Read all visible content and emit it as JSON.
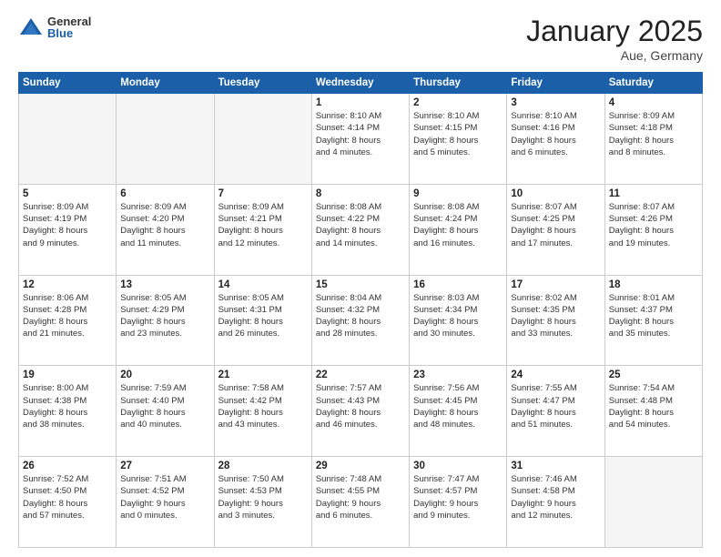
{
  "header": {
    "logo_general": "General",
    "logo_blue": "Blue",
    "title": "January 2025",
    "subtitle": "Aue, Germany"
  },
  "weekdays": [
    "Sunday",
    "Monday",
    "Tuesday",
    "Wednesday",
    "Thursday",
    "Friday",
    "Saturday"
  ],
  "weeks": [
    [
      {
        "day": "",
        "info": ""
      },
      {
        "day": "",
        "info": ""
      },
      {
        "day": "",
        "info": ""
      },
      {
        "day": "1",
        "info": "Sunrise: 8:10 AM\nSunset: 4:14 PM\nDaylight: 8 hours\nand 4 minutes."
      },
      {
        "day": "2",
        "info": "Sunrise: 8:10 AM\nSunset: 4:15 PM\nDaylight: 8 hours\nand 5 minutes."
      },
      {
        "day": "3",
        "info": "Sunrise: 8:10 AM\nSunset: 4:16 PM\nDaylight: 8 hours\nand 6 minutes."
      },
      {
        "day": "4",
        "info": "Sunrise: 8:09 AM\nSunset: 4:18 PM\nDaylight: 8 hours\nand 8 minutes."
      }
    ],
    [
      {
        "day": "5",
        "info": "Sunrise: 8:09 AM\nSunset: 4:19 PM\nDaylight: 8 hours\nand 9 minutes."
      },
      {
        "day": "6",
        "info": "Sunrise: 8:09 AM\nSunset: 4:20 PM\nDaylight: 8 hours\nand 11 minutes."
      },
      {
        "day": "7",
        "info": "Sunrise: 8:09 AM\nSunset: 4:21 PM\nDaylight: 8 hours\nand 12 minutes."
      },
      {
        "day": "8",
        "info": "Sunrise: 8:08 AM\nSunset: 4:22 PM\nDaylight: 8 hours\nand 14 minutes."
      },
      {
        "day": "9",
        "info": "Sunrise: 8:08 AM\nSunset: 4:24 PM\nDaylight: 8 hours\nand 16 minutes."
      },
      {
        "day": "10",
        "info": "Sunrise: 8:07 AM\nSunset: 4:25 PM\nDaylight: 8 hours\nand 17 minutes."
      },
      {
        "day": "11",
        "info": "Sunrise: 8:07 AM\nSunset: 4:26 PM\nDaylight: 8 hours\nand 19 minutes."
      }
    ],
    [
      {
        "day": "12",
        "info": "Sunrise: 8:06 AM\nSunset: 4:28 PM\nDaylight: 8 hours\nand 21 minutes."
      },
      {
        "day": "13",
        "info": "Sunrise: 8:05 AM\nSunset: 4:29 PM\nDaylight: 8 hours\nand 23 minutes."
      },
      {
        "day": "14",
        "info": "Sunrise: 8:05 AM\nSunset: 4:31 PM\nDaylight: 8 hours\nand 26 minutes."
      },
      {
        "day": "15",
        "info": "Sunrise: 8:04 AM\nSunset: 4:32 PM\nDaylight: 8 hours\nand 28 minutes."
      },
      {
        "day": "16",
        "info": "Sunrise: 8:03 AM\nSunset: 4:34 PM\nDaylight: 8 hours\nand 30 minutes."
      },
      {
        "day": "17",
        "info": "Sunrise: 8:02 AM\nSunset: 4:35 PM\nDaylight: 8 hours\nand 33 minutes."
      },
      {
        "day": "18",
        "info": "Sunrise: 8:01 AM\nSunset: 4:37 PM\nDaylight: 8 hours\nand 35 minutes."
      }
    ],
    [
      {
        "day": "19",
        "info": "Sunrise: 8:00 AM\nSunset: 4:38 PM\nDaylight: 8 hours\nand 38 minutes."
      },
      {
        "day": "20",
        "info": "Sunrise: 7:59 AM\nSunset: 4:40 PM\nDaylight: 8 hours\nand 40 minutes."
      },
      {
        "day": "21",
        "info": "Sunrise: 7:58 AM\nSunset: 4:42 PM\nDaylight: 8 hours\nand 43 minutes."
      },
      {
        "day": "22",
        "info": "Sunrise: 7:57 AM\nSunset: 4:43 PM\nDaylight: 8 hours\nand 46 minutes."
      },
      {
        "day": "23",
        "info": "Sunrise: 7:56 AM\nSunset: 4:45 PM\nDaylight: 8 hours\nand 48 minutes."
      },
      {
        "day": "24",
        "info": "Sunrise: 7:55 AM\nSunset: 4:47 PM\nDaylight: 8 hours\nand 51 minutes."
      },
      {
        "day": "25",
        "info": "Sunrise: 7:54 AM\nSunset: 4:48 PM\nDaylight: 8 hours\nand 54 minutes."
      }
    ],
    [
      {
        "day": "26",
        "info": "Sunrise: 7:52 AM\nSunset: 4:50 PM\nDaylight: 8 hours\nand 57 minutes."
      },
      {
        "day": "27",
        "info": "Sunrise: 7:51 AM\nSunset: 4:52 PM\nDaylight: 9 hours\nand 0 minutes."
      },
      {
        "day": "28",
        "info": "Sunrise: 7:50 AM\nSunset: 4:53 PM\nDaylight: 9 hours\nand 3 minutes."
      },
      {
        "day": "29",
        "info": "Sunrise: 7:48 AM\nSunset: 4:55 PM\nDaylight: 9 hours\nand 6 minutes."
      },
      {
        "day": "30",
        "info": "Sunrise: 7:47 AM\nSunset: 4:57 PM\nDaylight: 9 hours\nand 9 minutes."
      },
      {
        "day": "31",
        "info": "Sunrise: 7:46 AM\nSunset: 4:58 PM\nDaylight: 9 hours\nand 12 minutes."
      },
      {
        "day": "",
        "info": ""
      }
    ]
  ]
}
